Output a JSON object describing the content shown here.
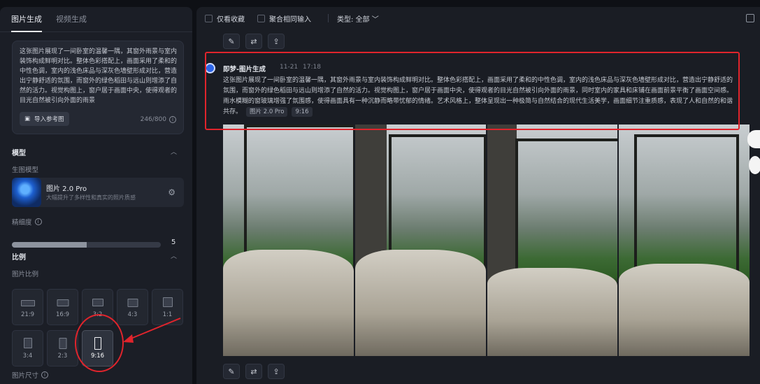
{
  "left": {
    "tabs": [
      "图片生成",
      "视频生成"
    ],
    "prompt": "这张图片展现了一间卧室的温馨一隅，其窗外雨景与室内装饰构成鲜明对比。整体色彩搭配上，画面采用了柔和的中性色调，室内的浅色床品与深灰色墙壁形成对比，营造出宁静舒适的氛围，而窗外的绿色稻田与远山则增添了自然的活力。视觉构图上，窗户居于画面中央，使得观者的目光自然被引向外面的雨景",
    "import_ref": "导入参考图",
    "counter": "246/800",
    "model_title": "模型",
    "gen_model_label": "生图模型",
    "model_name": "图片 2.0 Pro",
    "model_desc": "大幅提升了多样性和真实的照片质感",
    "precision_label": "精细度",
    "precision_value": "5",
    "precision_fraction": 0.5,
    "ratio_title": "比例",
    "ratio_label": "图片比例",
    "ratios": [
      "21:9",
      "16:9",
      "3:2",
      "4:3",
      "1:1",
      "3:4",
      "2:3",
      "9:16"
    ],
    "selected_ratio": "9:16",
    "size_label": "图片尺寸"
  },
  "topbar": {
    "only_fav": "仅看收藏",
    "merge_input": "聚合相同输入",
    "type_label": "类型: 全部"
  },
  "post": {
    "author": "即梦-图片生成",
    "date": "11-21",
    "time": "17:18",
    "description": "这张图片展现了一间卧室的温馨一隅，其窗外雨景与室内装饰构成鲜明对比。整体色彩搭配上，画面采用了柔和的中性色调，室内的浅色床品与深灰色墙壁形成对比，营造出宁静舒适的氛围，而窗外的绿色稻田与远山则增添了自然的活力。视觉构图上，窗户居于画面中央，使得观者的目光自然被引向外面的雨景，同时室内的家具和床铺在画面前景平衡了画面空间感。雨水模糊的窗玻璃增强了氛围感，使得画面具有一种沉静而略带忧郁的情绪。艺术风格上，整体呈现出一种极简与自然结合的现代生活美学，画面细节注重质感，表现了人和自然的和谐共存。",
    "model_tag": "图片 2.0 Pro",
    "ratio_tag": "9:16"
  },
  "colors": {
    "annotation_red": "#e0242c",
    "accent_blue": "#2d65e8"
  }
}
